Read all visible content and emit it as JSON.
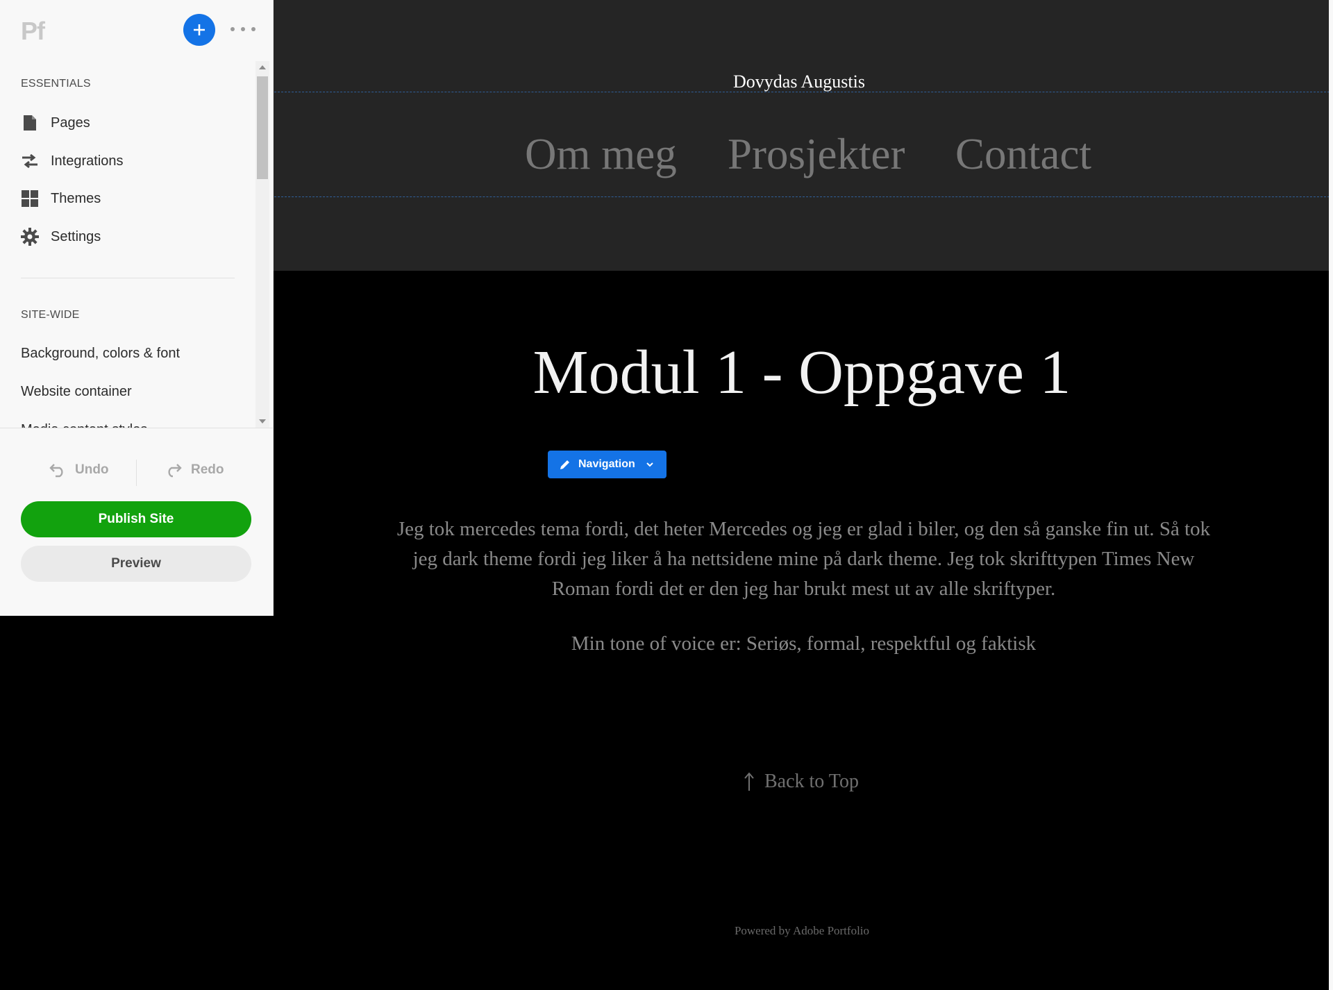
{
  "editor": {
    "logo": "Pf",
    "essentials_title": "ESSENTIALS",
    "essentials": [
      {
        "label": "Pages",
        "icon": "page-icon"
      },
      {
        "label": "Integrations",
        "icon": "integrations-icon"
      },
      {
        "label": "Themes",
        "icon": "themes-icon"
      },
      {
        "label": "Settings",
        "icon": "gear-icon"
      }
    ],
    "sitewide_title": "SITE-WIDE",
    "sitewide": [
      {
        "label": "Background, colors & font"
      },
      {
        "label": "Website container"
      },
      {
        "label": "Media content styles"
      }
    ],
    "undo_label": "Undo",
    "redo_label": "Redo",
    "publish_label": "Publish Site",
    "preview_label": "Preview",
    "accent_color": "#1473e6",
    "publish_color": "#12a20e"
  },
  "site": {
    "title": "Dovydas Augustis",
    "nav": [
      "Om meg",
      "Prosjekter",
      "Contact"
    ],
    "nav_edit_label": "Navigation",
    "heading": "Modul 1 - Oppgave 1",
    "paragraph1": "Jeg tok mercedes tema fordi, det heter Mercedes og jeg er glad i biler, og den så ganske fin ut. Så tok jeg dark theme fordi jeg liker å ha nettsidene mine på dark theme. Jeg tok skrifttypen Times New Roman fordi det er den jeg har brukt mest ut av alle skriftyper.",
    "paragraph2": "Min tone of voice er: Seriøs, formal, respektful og faktisk",
    "back_to_top": "Back to Top",
    "powered_by": "Powered by Adobe Portfolio"
  }
}
